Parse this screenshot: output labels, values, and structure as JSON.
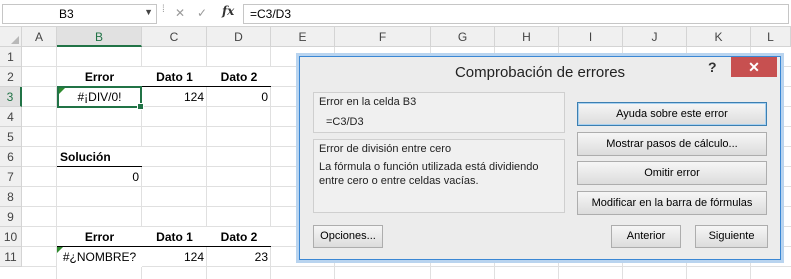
{
  "formula_bar": {
    "name_box": "B3",
    "name_box_arrow": "▼",
    "separator": "⁞",
    "cancel": "✕",
    "enter": "✓",
    "fx_label": "fx",
    "formula": "=C3/D3"
  },
  "sheet": {
    "columns": [
      "A",
      "B",
      "C",
      "D",
      "E",
      "F",
      "G",
      "H",
      "I",
      "J",
      "K",
      "L"
    ],
    "rows": [
      "1",
      "2",
      "3",
      "4",
      "5",
      "6",
      "7",
      "8",
      "9",
      "10",
      "11"
    ],
    "selected_column": "B",
    "selected_row": "3",
    "cells": {
      "B2": "Error",
      "C2": "Dato 1",
      "D2": "Dato 2",
      "B3": "#¡DIV/0!",
      "C3": "124",
      "D3": "0",
      "B6": "Solución",
      "B7": "0",
      "B10": "Error",
      "C10": "Dato 1",
      "D10": "Dato 2",
      "B11": "#¿NOMBRE?",
      "C11": "124",
      "D11": "23"
    }
  },
  "dialog": {
    "title": "Comprobación de errores",
    "help": "?",
    "close": "✕",
    "cell_group_label": "Error en la celda B3",
    "cell_formula": "=C3/D3",
    "error_type": "Error de división entre cero",
    "error_description": "La fórmula o función utilizada está dividiendo entre cero o entre celdas vacías.",
    "buttons": {
      "help": "Ayuda sobre este error",
      "show_steps": "Mostrar pasos de cálculo...",
      "ignore": "Omitir error",
      "edit_formula": "Modificar en la barra de fórmulas",
      "options": "Opciones...",
      "previous": "Anterior",
      "next": "Siguiente"
    }
  }
}
